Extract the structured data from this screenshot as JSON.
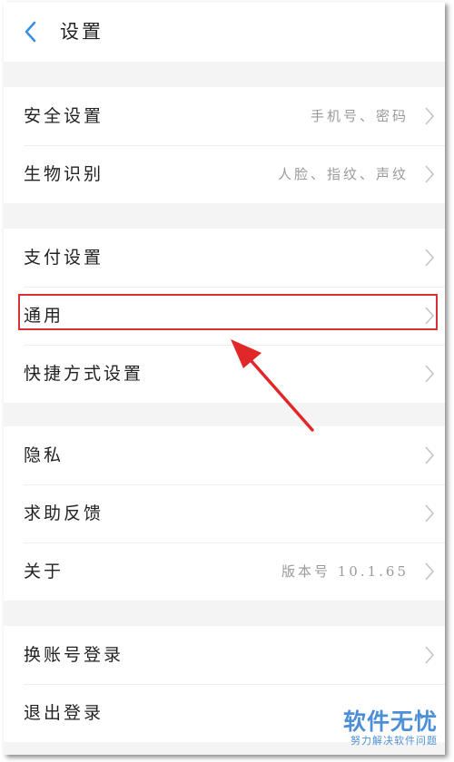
{
  "header": {
    "title": "设置",
    "back_icon": "chevron-left-icon",
    "accent_color": "#3a8ee6"
  },
  "groups": [
    {
      "items": [
        {
          "label": "安全设置",
          "value": "手机号、密码"
        },
        {
          "label": "生物识别",
          "value": "人脸、指纹、声纹"
        }
      ]
    },
    {
      "items": [
        {
          "label": "支付设置",
          "value": ""
        },
        {
          "label": "通用",
          "value": ""
        },
        {
          "label": "快捷方式设置",
          "value": ""
        }
      ]
    },
    {
      "items": [
        {
          "label": "隐私",
          "value": ""
        },
        {
          "label": "求助反馈",
          "value": ""
        },
        {
          "label": "关于",
          "value": "版本号 10.1.65"
        }
      ]
    },
    {
      "items": [
        {
          "label": "换账号登录",
          "value": ""
        },
        {
          "label": "退出登录",
          "value": ""
        }
      ]
    }
  ],
  "annotation": {
    "highlighted_item": "通用",
    "highlight_color": "#d93030"
  },
  "watermark": {
    "title": "软件无忧",
    "subtitle": "努力解决软件问题",
    "color": "#4d8fd6"
  }
}
